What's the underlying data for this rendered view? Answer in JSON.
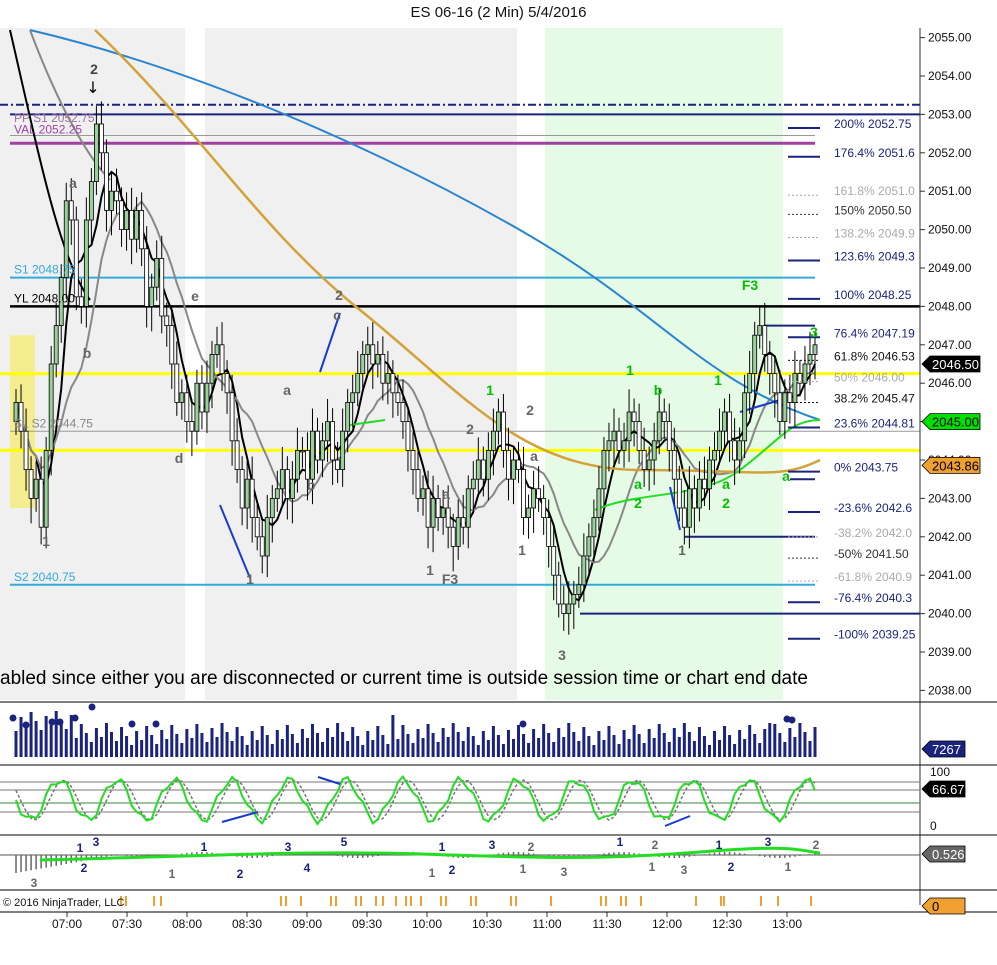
{
  "chart_data": {
    "type": "candlestick",
    "title": "ES 06-16 (2 Min)  5/4/2016",
    "watermark": "abled since either you are disconnected or current time is outside session time or chart end date",
    "copyright": "© 2016 NinjaTrader, LLC",
    "ylim": [
      2037.75,
      2055.25
    ],
    "price_ticks": [
      "2055.00",
      "2054.00",
      "2053.00",
      "2052.00",
      "2051.00",
      "2050.00",
      "2049.00",
      "2048.00",
      "2047.00",
      "2046.00",
      "2045.00",
      "2044.00",
      "2043.00",
      "2042.00",
      "2041.00",
      "2040.00",
      "2039.00",
      "2038.00"
    ],
    "time_ticks": [
      "07:00",
      "07:30",
      "08:00",
      "08:30",
      "09:00",
      "09:30",
      "10:00",
      "10:30",
      "11:00",
      "11:30",
      "12:00",
      "12:30",
      "13:00"
    ],
    "candles_close": [
      2045.5,
      2044.75,
      2043.75,
      2043.0,
      2043.5,
      2042.25,
      2044.25,
      2046.5,
      2047.5,
      2048.75,
      2050.75,
      2050.25,
      2048.25,
      2048.0,
      2050.25,
      2051.25,
      2052.75,
      2052.0,
      2050.5,
      2051.0,
      2050.75,
      2050.0,
      2050.5,
      2049.75,
      2050.5,
      2049.5,
      2048.0,
      2048.5,
      2049.25,
      2047.75,
      2047.5,
      2046.5,
      2045.5,
      2045.75,
      2045.0,
      2044.75,
      2046.0,
      2045.25,
      2046.0,
      2046.75,
      2047.0,
      2046.25,
      2045.75,
      2044.5,
      2043.75,
      2042.75,
      2043.5,
      2042.5,
      2042.0,
      2041.5,
      2042.5,
      2043.0,
      2043.25,
      2043.75,
      2043.0,
      2043.5,
      2044.25,
      2044.25,
      2043.5,
      2044.75,
      2044.0,
      2044.5,
      2045.0,
      2044.0,
      2043.75,
      2044.75,
      2045.5,
      2045.75,
      2046.25,
      2046.75,
      2047.0,
      2046.5,
      2046.75,
      2046.0,
      2046.25,
      2045.75,
      2045.5,
      2045.0,
      2044.25,
      2043.75,
      2043.0,
      2043.25,
      2042.25,
      2043.0,
      2042.5,
      2042.75,
      2042.25,
      2041.75,
      2042.5,
      2042.25,
      2043.25,
      2043.5,
      2044.0,
      2043.5,
      2044.25,
      2044.75,
      2045.25,
      2044.25,
      2043.5,
      2044.0,
      2043.75,
      2042.5,
      2042.75,
      2043.25,
      2043.0,
      2042.5,
      2041.75,
      2041.0,
      2040.25,
      2040.0,
      2040.25,
      2040.5,
      2040.75,
      2041.5,
      2042.0,
      2042.5,
      2043.25,
      2044.25,
      2044.5,
      2044.75,
      2044.25,
      2044.5,
      2045.25,
      2045.0,
      2044.25,
      2043.75,
      2044.0,
      2044.5,
      2045.25,
      2045.0,
      2044.25,
      2043.5,
      2042.75,
      2042.25,
      2043.25,
      2042.75,
      2043.5,
      2043.25,
      2044.0,
      2044.25,
      2044.75,
      2045.25,
      2044.5,
      2044.0,
      2044.5,
      2045.75,
      2046.25,
      2047.25,
      2047.5,
      2046.75,
      2046.25,
      2045.75,
      2045.0,
      2045.75,
      2045.5,
      2046.25,
      2046.0,
      2046.5,
      2046.75,
      2047.0
    ]
  },
  "levels": {
    "pp_s1": "PP S1 2052.75",
    "val": "VAL 2052.25",
    "s1": "S1 2048.75",
    "yl": "YL 2048.00",
    "sl_s2": "SL S2 2044.75",
    "s2": "S2 2040.75"
  },
  "fib_labels": [
    {
      "text": "200%  2052.75",
      "price": 2052.75,
      "color": "#1a237e"
    },
    {
      "text": "176.4%  2051.6",
      "price": 2052.0,
      "color": "#1a237e"
    },
    {
      "text": "161.8%  2051.0",
      "price": 2051.0,
      "color": "#aaaaaa"
    },
    {
      "text": "150%  2050.50",
      "price": 2050.5,
      "color": "#333333"
    },
    {
      "text": "138.2%  2049.9",
      "price": 2049.9,
      "color": "#aaaaaa"
    },
    {
      "text": "123.6%  2049.3",
      "price": 2049.3,
      "color": "#1a237e"
    },
    {
      "text": "100%  2048.25",
      "price": 2048.3,
      "color": "#1a237e"
    },
    {
      "text": "76.4%  2047.19",
      "price": 2047.3,
      "color": "#1a237e"
    },
    {
      "text": "61.8%  2046.53",
      "price": 2046.7,
      "color": "#111111"
    },
    {
      "text": "50%  2046.00",
      "price": 2046.15,
      "color": "#aaaaaa"
    },
    {
      "text": "38.2%  2045.47",
      "price": 2045.6,
      "color": "#111111"
    },
    {
      "text": "23.6%  2044.81",
      "price": 2044.95,
      "color": "#1a237e"
    },
    {
      "text": "0%  2043.75",
      "price": 2043.8,
      "color": "#1a237e"
    },
    {
      "text": "-23.6%  2042.6",
      "price": 2042.75,
      "color": "#1a237e"
    },
    {
      "text": "-38.2%  2042.0",
      "price": 2042.1,
      "color": "#aaaaaa"
    },
    {
      "text": "-50%  2041.50",
      "price": 2041.55,
      "color": "#333333"
    },
    {
      "text": "-61.8%  2040.9",
      "price": 2040.95,
      "color": "#aaaaaa"
    },
    {
      "text": "-76.4%  2040.3",
      "price": 2040.4,
      "color": "#1a237e"
    },
    {
      "text": "-100%  2039.25",
      "price": 2039.45,
      "color": "#1a237e"
    }
  ],
  "price_tags": [
    {
      "text": "2046.50",
      "price": 2046.5,
      "bg": "#000000",
      "fg": "#ffffff"
    },
    {
      "text": "2045.00",
      "price": 2045.0,
      "bg": "#00e000",
      "fg": "#000000"
    },
    {
      "text": "2043.86",
      "price": 2043.86,
      "bg": "#f0a030",
      "fg": "#000000"
    }
  ],
  "marks": [
    {
      "t": "2",
      "x": 94,
      "y": 74,
      "c": "#444444"
    },
    {
      "t": "a",
      "x": 73,
      "y": 188,
      "c": "#666666"
    },
    {
      "t": "b",
      "x": 87,
      "y": 358,
      "c": "#666666"
    },
    {
      "t": "e",
      "x": 195,
      "y": 301,
      "c": "#666666"
    },
    {
      "t": "d",
      "x": 179,
      "y": 463,
      "c": "#666666"
    },
    {
      "t": "1",
      "x": 46,
      "y": 546,
      "c": "#666666"
    },
    {
      "t": "a",
      "x": 287,
      "y": 395,
      "c": "#666666"
    },
    {
      "t": "b",
      "x": 311,
      "y": 490,
      "c": "#666666"
    },
    {
      "t": "2",
      "x": 339,
      "y": 300,
      "c": "#666666"
    },
    {
      "t": "c",
      "x": 337,
      "y": 320,
      "c": "#666666"
    },
    {
      "t": "1",
      "x": 250,
      "y": 584,
      "c": "#666666"
    },
    {
      "t": "2",
      "x": 470,
      "y": 434,
      "c": "#666666"
    },
    {
      "t": "a",
      "x": 446,
      "y": 499,
      "c": "#666666"
    },
    {
      "t": "1",
      "x": 430,
      "y": 575,
      "c": "#666666"
    },
    {
      "t": "F3",
      "x": 450,
      "y": 584,
      "c": "#666666"
    },
    {
      "t": "1",
      "x": 490,
      "y": 395,
      "c": "#00c000"
    },
    {
      "t": "2",
      "x": 530,
      "y": 415,
      "c": "#666666"
    },
    {
      "t": "a",
      "x": 534,
      "y": 461,
      "c": "#666666"
    },
    {
      "t": "1",
      "x": 522,
      "y": 555,
      "c": "#666666"
    },
    {
      "t": "3",
      "x": 562,
      "y": 660,
      "c": "#666666"
    },
    {
      "t": "1",
      "x": 630,
      "y": 375,
      "c": "#00c000"
    },
    {
      "t": "b",
      "x": 658,
      "y": 395,
      "c": "#00c000"
    },
    {
      "t": "a",
      "x": 638,
      "y": 489,
      "c": "#00c000"
    },
    {
      "t": "2",
      "x": 638,
      "y": 508,
      "c": "#00c000"
    },
    {
      "t": "1",
      "x": 682,
      "y": 555,
      "c": "#666666"
    },
    {
      "t": "1",
      "x": 718,
      "y": 385,
      "c": "#00c000"
    },
    {
      "t": "a",
      "x": 726,
      "y": 489,
      "c": "#00c000"
    },
    {
      "t": "2",
      "x": 726,
      "y": 508,
      "c": "#00c000"
    },
    {
      "t": "F3",
      "x": 750,
      "y": 290,
      "c": "#00c000"
    },
    {
      "t": "3",
      "x": 814,
      "y": 337,
      "c": "#00c000"
    },
    {
      "t": "a",
      "x": 786,
      "y": 481,
      "c": "#00c000"
    }
  ],
  "panels": {
    "volume_tag": "7267",
    "stoch_tag": "66.67",
    "stoch_top": "100",
    "stoch_bottom": "0",
    "macd_tag": "0.526",
    "bottom_tag": "0",
    "macd_marks": [
      {
        "t": "1",
        "x": 80,
        "y": 852,
        "c": "#1a237e"
      },
      {
        "t": "3",
        "x": 96,
        "y": 846,
        "c": "#1a237e"
      },
      {
        "t": "2",
        "x": 84,
        "y": 872,
        "c": "#1a237e"
      },
      {
        "t": "3",
        "x": 34,
        "y": 887,
        "c": "#666666"
      },
      {
        "t": "1",
        "x": 172,
        "y": 878,
        "c": "#666666"
      },
      {
        "t": "1",
        "x": 204,
        "y": 851,
        "c": "#1a237e"
      },
      {
        "t": "2",
        "x": 240,
        "y": 878,
        "c": "#1a237e"
      },
      {
        "t": "3",
        "x": 288,
        "y": 851,
        "c": "#1a237e"
      },
      {
        "t": "4",
        "x": 307,
        "y": 872,
        "c": "#1a237e"
      },
      {
        "t": "5",
        "x": 344,
        "y": 846,
        "c": "#1a237e"
      },
      {
        "t": "1",
        "x": 442,
        "y": 851,
        "c": "#1a237e"
      },
      {
        "t": "1",
        "x": 432,
        "y": 877,
        "c": "#666666"
      },
      {
        "t": "2",
        "x": 452,
        "y": 874,
        "c": "#1a237e"
      },
      {
        "t": "3",
        "x": 492,
        "y": 849,
        "c": "#1a237e"
      },
      {
        "t": "2",
        "x": 531,
        "y": 851,
        "c": "#666666"
      },
      {
        "t": "1",
        "x": 523,
        "y": 873,
        "c": "#666666"
      },
      {
        "t": "3",
        "x": 564,
        "y": 876,
        "c": "#666666"
      },
      {
        "t": "1",
        "x": 620,
        "y": 846,
        "c": "#1a237e"
      },
      {
        "t": "2",
        "x": 655,
        "y": 849,
        "c": "#666666"
      },
      {
        "t": "1",
        "x": 652,
        "y": 871,
        "c": "#666666"
      },
      {
        "t": "3",
        "x": 684,
        "y": 874,
        "c": "#666666"
      },
      {
        "t": "1",
        "x": 719,
        "y": 849,
        "c": "#1a237e"
      },
      {
        "t": "2",
        "x": 731,
        "y": 871,
        "c": "#1a237e"
      },
      {
        "t": "3",
        "x": 768,
        "y": 846,
        "c": "#1a237e"
      },
      {
        "t": "1",
        "x": 788,
        "y": 871,
        "c": "#666666"
      },
      {
        "t": "2",
        "x": 816,
        "y": 849,
        "c": "#666666"
      }
    ]
  },
  "colors": {
    "up_candle": "#9ad19a",
    "down_candle": "#ffffff",
    "wick": "#000000",
    "sma_fast": "#000000",
    "sma_gray": "#888888",
    "ema_blue": "#2a85d0",
    "ema_gold": "#d4a23a",
    "green_ma": "#22dd22",
    "yellow_zone": "#ffff00",
    "s_line": "#33aadd",
    "val_line": "#a040a0",
    "navy": "#1a237e",
    "shade_gray": "#f0f0f0",
    "shade_green": "#e6fbe6",
    "shade_yellow": "#f4ed90"
  }
}
